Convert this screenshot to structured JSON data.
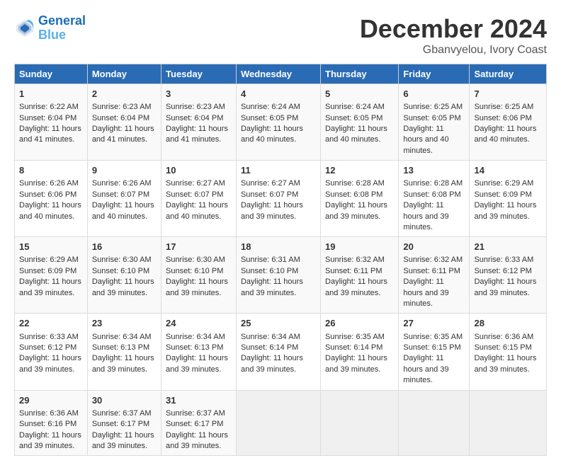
{
  "logo": {
    "line1": "General",
    "line2": "Blue"
  },
  "title": "December 2024",
  "subtitle": "Gbanvyelou, Ivory Coast",
  "days_of_week": [
    "Sunday",
    "Monday",
    "Tuesday",
    "Wednesday",
    "Thursday",
    "Friday",
    "Saturday"
  ],
  "weeks": [
    [
      {
        "day": "1",
        "sunrise": "6:22 AM",
        "sunset": "6:04 PM",
        "daylight": "11 hours and 41 minutes."
      },
      {
        "day": "2",
        "sunrise": "6:23 AM",
        "sunset": "6:04 PM",
        "daylight": "11 hours and 41 minutes."
      },
      {
        "day": "3",
        "sunrise": "6:23 AM",
        "sunset": "6:04 PM",
        "daylight": "11 hours and 41 minutes."
      },
      {
        "day": "4",
        "sunrise": "6:24 AM",
        "sunset": "6:05 PM",
        "daylight": "11 hours and 40 minutes."
      },
      {
        "day": "5",
        "sunrise": "6:24 AM",
        "sunset": "6:05 PM",
        "daylight": "11 hours and 40 minutes."
      },
      {
        "day": "6",
        "sunrise": "6:25 AM",
        "sunset": "6:05 PM",
        "daylight": "11 hours and 40 minutes."
      },
      {
        "day": "7",
        "sunrise": "6:25 AM",
        "sunset": "6:06 PM",
        "daylight": "11 hours and 40 minutes."
      }
    ],
    [
      {
        "day": "8",
        "sunrise": "6:26 AM",
        "sunset": "6:06 PM",
        "daylight": "11 hours and 40 minutes."
      },
      {
        "day": "9",
        "sunrise": "6:26 AM",
        "sunset": "6:07 PM",
        "daylight": "11 hours and 40 minutes."
      },
      {
        "day": "10",
        "sunrise": "6:27 AM",
        "sunset": "6:07 PM",
        "daylight": "11 hours and 40 minutes."
      },
      {
        "day": "11",
        "sunrise": "6:27 AM",
        "sunset": "6:07 PM",
        "daylight": "11 hours and 39 minutes."
      },
      {
        "day": "12",
        "sunrise": "6:28 AM",
        "sunset": "6:08 PM",
        "daylight": "11 hours and 39 minutes."
      },
      {
        "day": "13",
        "sunrise": "6:28 AM",
        "sunset": "6:08 PM",
        "daylight": "11 hours and 39 minutes."
      },
      {
        "day": "14",
        "sunrise": "6:29 AM",
        "sunset": "6:09 PM",
        "daylight": "11 hours and 39 minutes."
      }
    ],
    [
      {
        "day": "15",
        "sunrise": "6:29 AM",
        "sunset": "6:09 PM",
        "daylight": "11 hours and 39 minutes."
      },
      {
        "day": "16",
        "sunrise": "6:30 AM",
        "sunset": "6:10 PM",
        "daylight": "11 hours and 39 minutes."
      },
      {
        "day": "17",
        "sunrise": "6:30 AM",
        "sunset": "6:10 PM",
        "daylight": "11 hours and 39 minutes."
      },
      {
        "day": "18",
        "sunrise": "6:31 AM",
        "sunset": "6:10 PM",
        "daylight": "11 hours and 39 minutes."
      },
      {
        "day": "19",
        "sunrise": "6:32 AM",
        "sunset": "6:11 PM",
        "daylight": "11 hours and 39 minutes."
      },
      {
        "day": "20",
        "sunrise": "6:32 AM",
        "sunset": "6:11 PM",
        "daylight": "11 hours and 39 minutes."
      },
      {
        "day": "21",
        "sunrise": "6:33 AM",
        "sunset": "6:12 PM",
        "daylight": "11 hours and 39 minutes."
      }
    ],
    [
      {
        "day": "22",
        "sunrise": "6:33 AM",
        "sunset": "6:12 PM",
        "daylight": "11 hours and 39 minutes."
      },
      {
        "day": "23",
        "sunrise": "6:34 AM",
        "sunset": "6:13 PM",
        "daylight": "11 hours and 39 minutes."
      },
      {
        "day": "24",
        "sunrise": "6:34 AM",
        "sunset": "6:13 PM",
        "daylight": "11 hours and 39 minutes."
      },
      {
        "day": "25",
        "sunrise": "6:34 AM",
        "sunset": "6:14 PM",
        "daylight": "11 hours and 39 minutes."
      },
      {
        "day": "26",
        "sunrise": "6:35 AM",
        "sunset": "6:14 PM",
        "daylight": "11 hours and 39 minutes."
      },
      {
        "day": "27",
        "sunrise": "6:35 AM",
        "sunset": "6:15 PM",
        "daylight": "11 hours and 39 minutes."
      },
      {
        "day": "28",
        "sunrise": "6:36 AM",
        "sunset": "6:15 PM",
        "daylight": "11 hours and 39 minutes."
      }
    ],
    [
      {
        "day": "29",
        "sunrise": "6:36 AM",
        "sunset": "6:16 PM",
        "daylight": "11 hours and 39 minutes."
      },
      {
        "day": "30",
        "sunrise": "6:37 AM",
        "sunset": "6:17 PM",
        "daylight": "11 hours and 39 minutes."
      },
      {
        "day": "31",
        "sunrise": "6:37 AM",
        "sunset": "6:17 PM",
        "daylight": "11 hours and 39 minutes."
      },
      null,
      null,
      null,
      null
    ]
  ]
}
